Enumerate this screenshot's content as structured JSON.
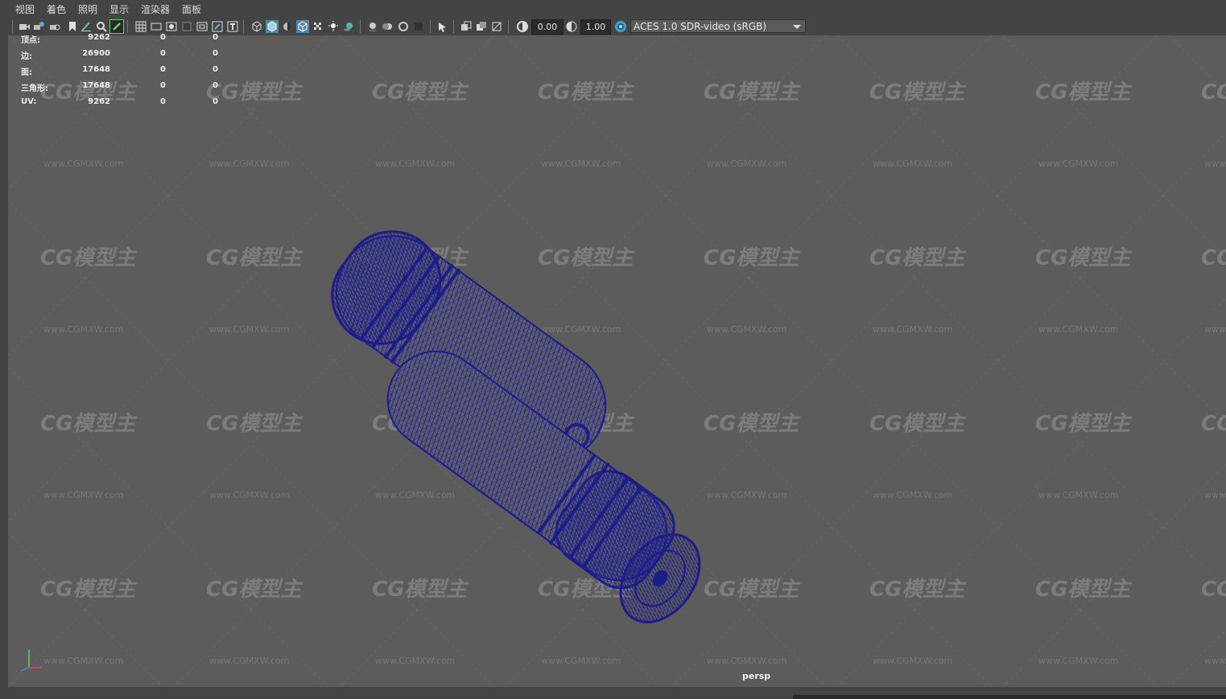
{
  "menu": {
    "items": [
      "视图",
      "着色",
      "照明",
      "显示",
      "渲染器",
      "面板"
    ]
  },
  "toolbar": {
    "exposure": "0.00",
    "gamma": "1.00",
    "color_space": "ACES 1.0 SDR-video (sRGB)"
  },
  "hud": {
    "rows": [
      {
        "label": "顶点:",
        "v1": "9262",
        "v2": "0",
        "v3": "0"
      },
      {
        "label": "边:",
        "v1": "26900",
        "v2": "0",
        "v3": "0"
      },
      {
        "label": "面:",
        "v1": "17648",
        "v2": "0",
        "v3": "0"
      },
      {
        "label": "三角形:",
        "v1": "17648",
        "v2": "0",
        "v3": "0"
      },
      {
        "label": "UV:",
        "v1": "9262",
        "v2": "0",
        "v3": "0"
      }
    ]
  },
  "viewport": {
    "camera_label": "persp",
    "background_color": "#5c5c5c",
    "wireframe_color": "#1c1c8a"
  },
  "watermark": {
    "logo_text": "CG模型主",
    "url_text": "www.CGMXW.com"
  }
}
